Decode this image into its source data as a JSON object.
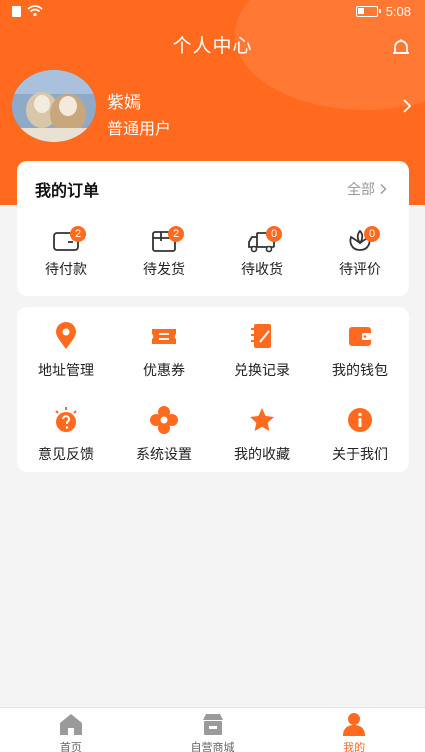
{
  "status_bar": {
    "time": "5:08"
  },
  "header": {
    "title": "个人中心"
  },
  "profile": {
    "username": "紫嫣",
    "user_type": "普通用户"
  },
  "orders": {
    "title": "我的订单",
    "see_all": "全部",
    "items": [
      {
        "label": "待付款",
        "count": "2",
        "icon": "wallet-icon"
      },
      {
        "label": "待发货",
        "count": "2",
        "icon": "package-icon"
      },
      {
        "label": "待收货",
        "count": "0",
        "icon": "truck-icon"
      },
      {
        "label": "待评价",
        "count": "0",
        "icon": "comment-flower-icon"
      }
    ]
  },
  "services": {
    "items": [
      {
        "label": "地址管理",
        "icon": "location-pin-icon"
      },
      {
        "label": "优惠券",
        "icon": "coupon-icon"
      },
      {
        "label": "兑换记录",
        "icon": "notebook-icon"
      },
      {
        "label": "我的钱包",
        "icon": "wallet-icon"
      },
      {
        "label": "意见反馈",
        "icon": "question-bulb-icon"
      },
      {
        "label": "系统设置",
        "icon": "settings-flower-icon"
      },
      {
        "label": "我的收藏",
        "icon": "star-icon"
      },
      {
        "label": "关于我们",
        "icon": "info-icon"
      }
    ]
  },
  "tabbar": {
    "items": [
      {
        "label": "首页",
        "icon": "home-icon"
      },
      {
        "label": "自营商城",
        "icon": "store-icon"
      },
      {
        "label": "我的",
        "icon": "profile-icon",
        "active": true
      }
    ]
  },
  "colors": {
    "accent": "#ff6a1f",
    "background": "#f4f4f4",
    "muted": "#999999"
  }
}
